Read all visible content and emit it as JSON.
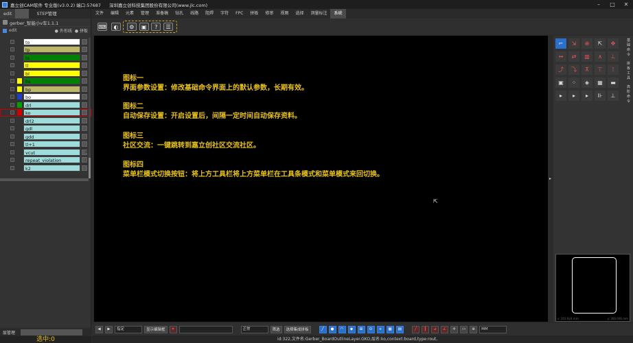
{
  "window": {
    "title": "嘉立创CAM软件 专业版(v3.0.2) 端口:57687",
    "company": "深圳嘉立创科技集团股份有限公司(www.jlc.com)"
  },
  "left_panel": {
    "tabs": [
      "edit",
      "",
      "STEP管理"
    ],
    "job_name": "gerber_智能小v车1.1.1",
    "sub_row": {
      "label": "edit",
      "opt1": "外形线",
      "opt2": "拼板"
    },
    "layers": [
      {
        "name": "to",
        "bg": "#ffffff",
        "chip": "#333333"
      },
      {
        "name": "tp",
        "bg": "#bdb76b",
        "chip": "#333333"
      },
      {
        "name": "ts",
        "bg": "#008000",
        "chip": "#333333"
      },
      {
        "name": "tl",
        "bg": "#ffff00",
        "chip": "#333333"
      },
      {
        "name": "bl",
        "bg": "#ffff00",
        "chip": "#333333"
      },
      {
        "name": "bs",
        "bg": "#008000",
        "chip": "#ffff00"
      },
      {
        "name": "bp",
        "bg": "#bdb76b",
        "chip": "#ffff00"
      },
      {
        "name": "bo",
        "bg": "#ffffff",
        "chip": "#1e3cd0"
      },
      {
        "name": "drl",
        "bg": "#9edcdc",
        "chip": "#00a000"
      },
      {
        "name": "ko",
        "bg": "#9edcdc",
        "chip": "#d00000",
        "selected": true
      },
      {
        "name": "drl2",
        "bg": "#9edcdc",
        "chip": "#333333"
      },
      {
        "name": "gdl",
        "bg": "#9edcdc",
        "chip": "#333333"
      },
      {
        "name": "gdd",
        "bg": "#9edcdc",
        "chip": "#333333"
      },
      {
        "name": "tl+1",
        "bg": "#9edcdc",
        "chip": "#333333"
      },
      {
        "name": "vcut",
        "bg": "#9edcdc",
        "chip": "#333333",
        "mark": "⊕"
      },
      {
        "name": "repeat_violation",
        "bg": "#9edcdc",
        "chip": "#333333",
        "mark": "○"
      },
      {
        "name": "k2",
        "bg": "#9edcdc",
        "chip": "#333333"
      }
    ],
    "bottom_label": "层管理",
    "selected_count": "选中:0"
  },
  "menu": [
    "文件",
    "编辑",
    "元素",
    "管理",
    "准备稿",
    "钻孔",
    "线路",
    "阻焊",
    "字符",
    "FPC",
    "拼板",
    "修审",
    "视图",
    "选择",
    "测量标注",
    "系统"
  ],
  "menu_active_index": 15,
  "toolbar": {
    "left_icons": [
      "keyboard-icon",
      "view-toggle-icon"
    ],
    "group_icons": [
      "gear-icon",
      "save-icon",
      "help-icon",
      "list-icon"
    ]
  },
  "annotations": [
    {
      "title": "图标一",
      "text": "界面参数设置：修改基础命令界面上的默认参数，长期有效。"
    },
    {
      "title": "图标二",
      "text": "自动保存设置：开启设置后，间隔一定时间自动保存资料。"
    },
    {
      "title": "图标三",
      "text": "社区交流：一键跳转到嘉立创社区交流社区。"
    },
    {
      "title": "图标四",
      "text": "菜单栏模式切换按钮：将上方工具栏将上方菜单栏在工具条模式和菜单模式来回切换。"
    }
  ],
  "right_panel": {
    "side_tabs": [
      "基础命令",
      "拼板工具",
      "高阶命令"
    ],
    "tool_rows": 7,
    "preview_coords": [
      "x: 202.924 mm",
      "y: 266.006 mm"
    ]
  },
  "bottom_bar": {
    "mode_label": "指定",
    "show_edit_button": "显示编辑框",
    "select_value": "正常",
    "cb1": "筛选",
    "cb2": "选择集成拼板",
    "unit": "MM"
  },
  "status_text": "id:322,文件名:Gerber_BoardOutlineLayer.GKO,层名:ko,context:board,type:rout,"
}
